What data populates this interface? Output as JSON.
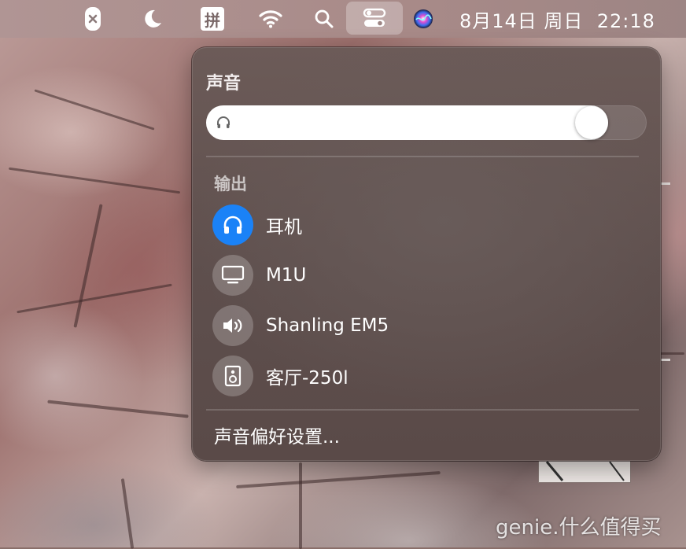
{
  "menubar": {
    "clock": "8月14日 周日  22:18",
    "input_method_label": "拼",
    "active_item": "control-center"
  },
  "sound_panel": {
    "title": "声音",
    "volume_level": 0.905,
    "output_section_label": "输出",
    "devices": [
      {
        "label": "耳机",
        "icon": "headphones-icon",
        "selected": true
      },
      {
        "label": "M1U",
        "icon": "display-icon",
        "selected": false
      },
      {
        "label": "Shanling EM5",
        "icon": "speaker-icon",
        "selected": false
      },
      {
        "label": "客厅-250l",
        "icon": "homepod-speaker-icon",
        "selected": false
      }
    ],
    "preferences_label": "声音偏好设置..."
  },
  "watermark": "genie.什么值得买",
  "colors": {
    "selected_device": "#1a82f7",
    "panel_bg": "#5e4f4d"
  }
}
